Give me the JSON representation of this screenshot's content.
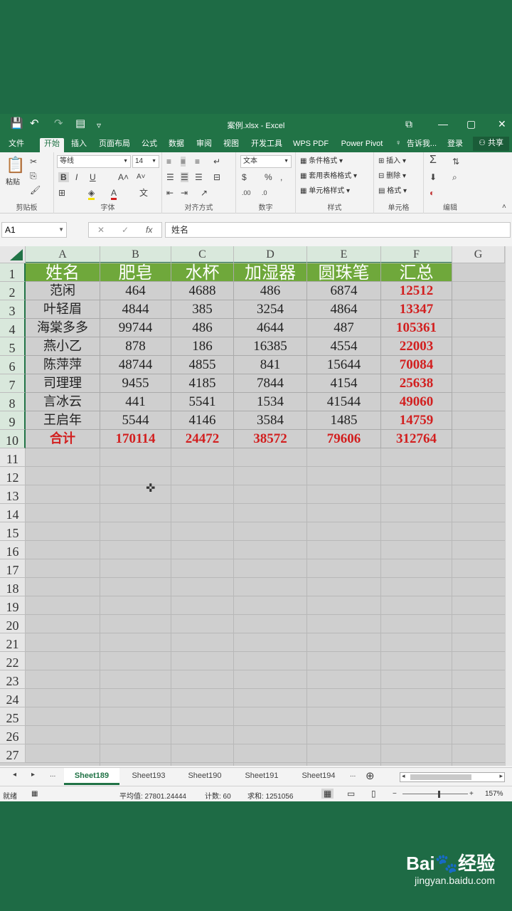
{
  "window": {
    "title": "案例.xlsx - Excel",
    "qat": [
      "💾",
      "↶",
      "↷",
      "▤",
      "▿"
    ],
    "controls": [
      "⧉",
      "—",
      "▢",
      "✕"
    ]
  },
  "menu": {
    "tabs": [
      "文件",
      "开始",
      "插入",
      "页面布局",
      "公式",
      "数据",
      "审阅",
      "视图",
      "开发工具",
      "WPS PDF",
      "Power Pivot",
      "告诉我...",
      "登录"
    ],
    "active_tab": "开始",
    "share": "共享"
  },
  "ribbon": {
    "clipboard_label": "剪贴板",
    "paste_label": "粘贴",
    "font_label": "字体",
    "font_name": "等线",
    "font_size": "14",
    "align_label": "对齐方式",
    "number_label": "数字",
    "number_format": "文本",
    "styles_label": "样式",
    "styles_items": [
      "条件格式",
      "套用表格格式",
      "单元格样式"
    ],
    "cells_label": "单元格",
    "cells_items": [
      "插入",
      "删除",
      "格式"
    ],
    "edit_label": "编辑"
  },
  "formula_bar": {
    "name_box": "A1",
    "content": "姓名"
  },
  "sheet": {
    "columns": [
      "A",
      "B",
      "C",
      "D",
      "E",
      "F",
      "G"
    ],
    "rows": [
      "1",
      "2",
      "3",
      "4",
      "5",
      "6",
      "7",
      "8",
      "9",
      "10",
      "11",
      "12",
      "13",
      "14",
      "15",
      "16",
      "17",
      "18",
      "19",
      "20",
      "21",
      "22",
      "23",
      "24",
      "25",
      "26",
      "27"
    ],
    "header": [
      "姓名",
      "肥皂",
      "水杯",
      "加湿器",
      "圆珠笔",
      "汇总"
    ],
    "data": [
      [
        "范闲",
        "464",
        "4688",
        "486",
        "6874",
        "12512"
      ],
      [
        "叶轻眉",
        "4844",
        "385",
        "3254",
        "4864",
        "13347"
      ],
      [
        "海棠多多",
        "99744",
        "486",
        "4644",
        "487",
        "105361"
      ],
      [
        "燕小乙",
        "878",
        "186",
        "16385",
        "4554",
        "22003"
      ],
      [
        "陈萍萍",
        "48744",
        "4855",
        "841",
        "15644",
        "70084"
      ],
      [
        "司理理",
        "9455",
        "4185",
        "7844",
        "4154",
        "25638"
      ],
      [
        "言冰云",
        "441",
        "5541",
        "1534",
        "41544",
        "49060"
      ],
      [
        "王启年",
        "5544",
        "4146",
        "3584",
        "1485",
        "14759"
      ]
    ],
    "total_row": [
      "合计",
      "170114",
      "24472",
      "38572",
      "79606",
      "312764"
    ]
  },
  "sheet_tabs": {
    "tabs": [
      "Sheet189",
      "Sheet193",
      "Sheet190",
      "Sheet191",
      "Sheet194"
    ],
    "active": "Sheet189",
    "more": "..."
  },
  "status": {
    "mode": "就绪",
    "average": "平均值: 27801.24444",
    "count": "计数: 60",
    "sum": "求和: 1251056",
    "zoom": "157%"
  },
  "watermark": {
    "brand": "Bai🐾经验",
    "site": "jingyan.baidu.com"
  },
  "colors": {
    "excel_green": "#217346",
    "header_fill": "#6fa83b",
    "total_red": "#d21f1f",
    "background": "#1e6b45"
  }
}
